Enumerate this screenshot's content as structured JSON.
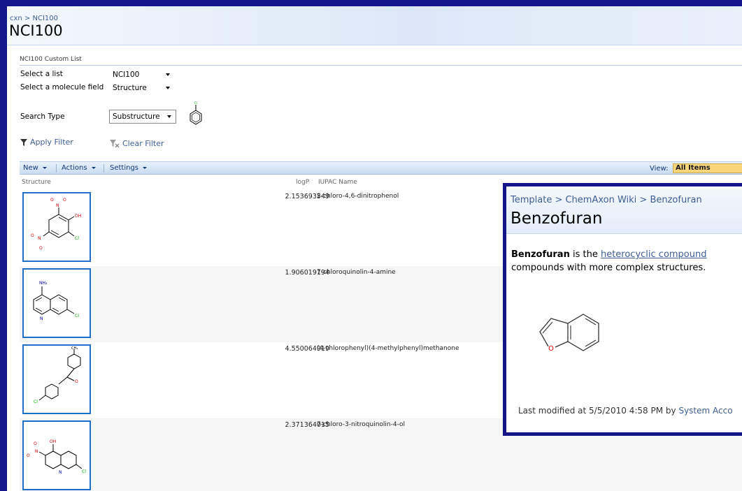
{
  "header": {
    "breadcrumb": "cxn > NCI100",
    "title": "NCI100"
  },
  "webpart": {
    "title": "NCI100 Custom List",
    "select_list_label": "Select a list",
    "select_list_value": "NCI100",
    "select_field_label": "Select a molecule field",
    "select_field_value": "Structure",
    "search_type_label": "Search Type",
    "search_type_value": "Substructure",
    "apply_filter": "Apply Filter",
    "clear_filter": "Clear Filter"
  },
  "toolbar": {
    "new_label": "New",
    "actions_label": "Actions",
    "settings_label": "Settings",
    "view_label": "View:",
    "view_value": "All Items"
  },
  "list": {
    "columns": [
      "Structure",
      "logP",
      "IUPAC Name"
    ],
    "rows": [
      {
        "logp": "2.153693549",
        "iupac": "2-chloro-4,6-dinitrophenol"
      },
      {
        "logp": "1.906019194",
        "iupac": "7-chloroquinolin-4-amine"
      },
      {
        "logp": "4.550064919",
        "iupac": "(4-chlorophenyl)(4-methylphenyl)methanone"
      },
      {
        "logp": "2.371364015",
        "iupac": "7-chloro-3-nitroquinolin-4-ol"
      }
    ]
  },
  "popup": {
    "breadcrumb": "Template > ChemAxon Wiki > Benzofuran",
    "title": "Benzofuran",
    "text_bold": "Benzofuran",
    "text_pre": " is the ",
    "text_link": "heterocyclic compound",
    "text_line2": "compounds with more complex structures.",
    "footer_pre": "Last modified at 5/5/2010 4:58 PM  by ",
    "footer_user": "System Acco"
  },
  "colors": {
    "frame": "#15158a",
    "link": "#3d5e93",
    "thumb_border": "#1f6fc8",
    "view_highlight": "#f9d67a"
  }
}
